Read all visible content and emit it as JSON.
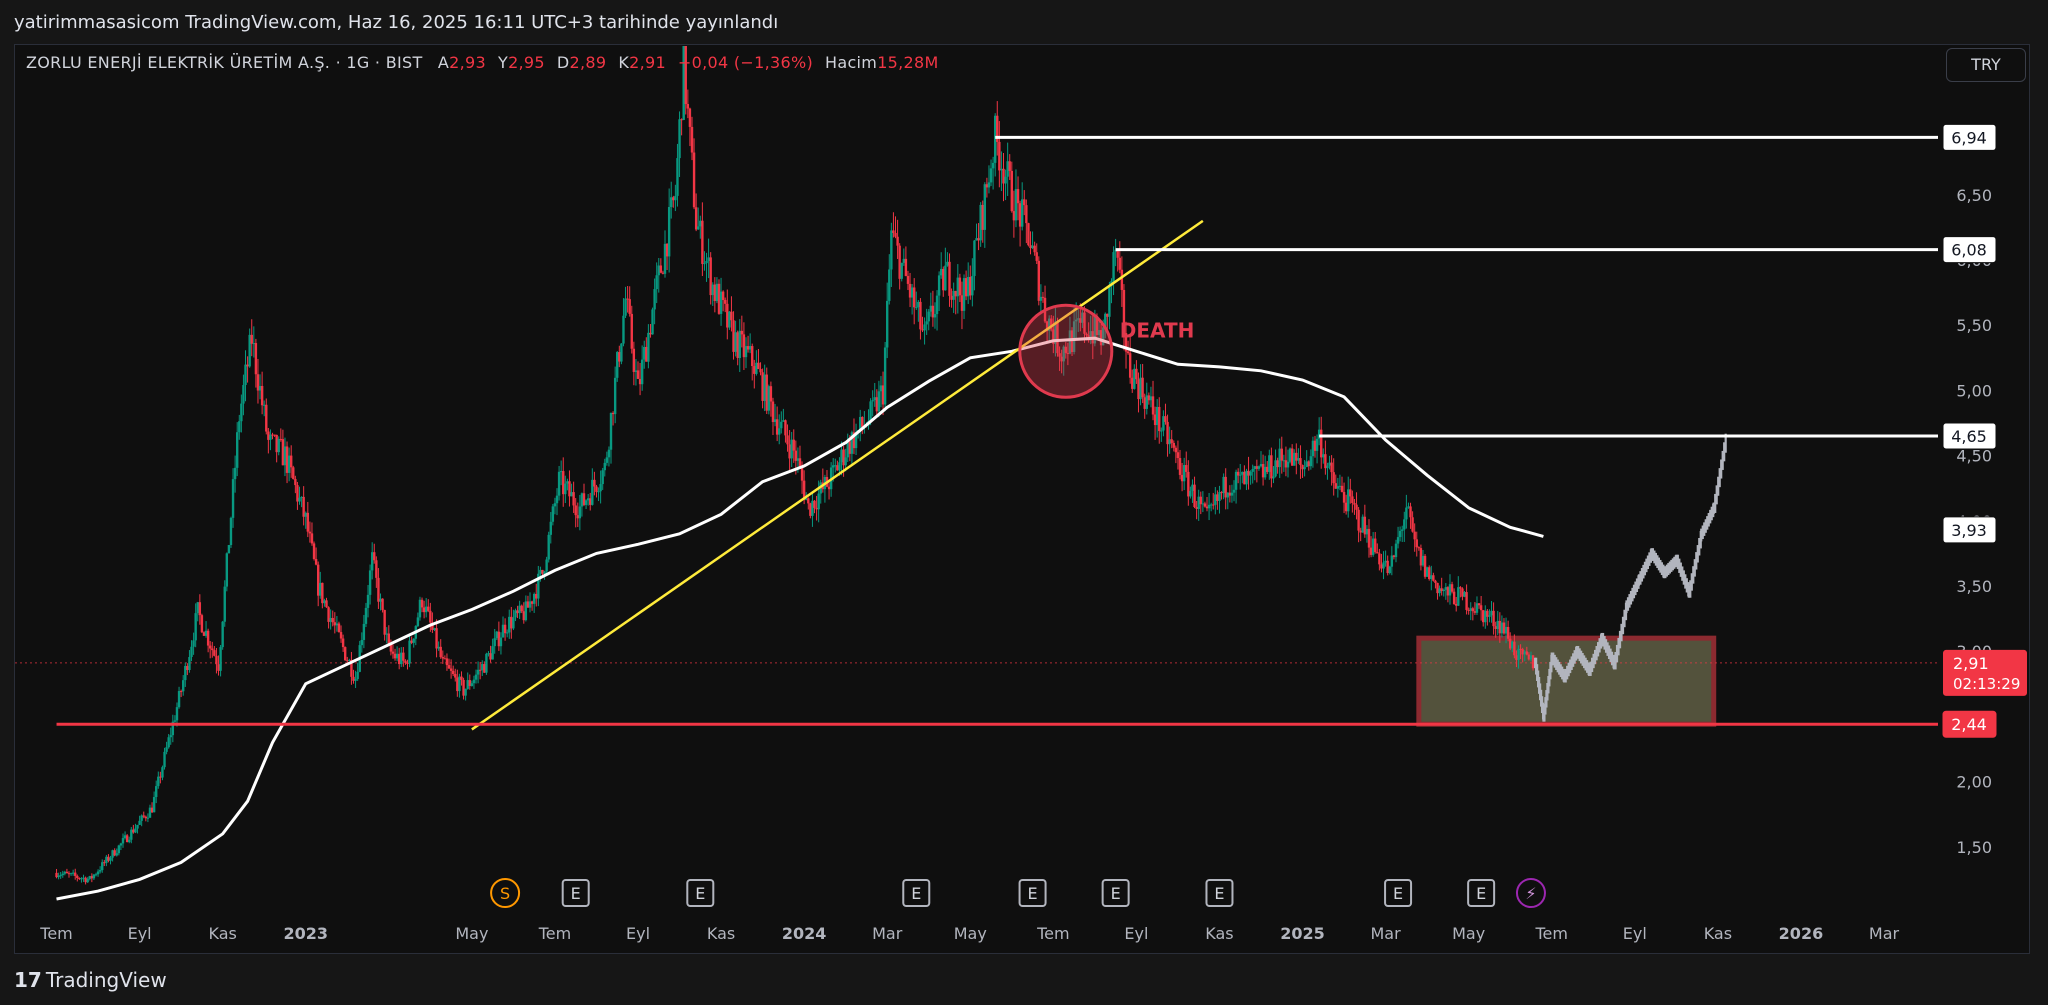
{
  "header": {
    "publish_line": "yatirimmasasicom TradingView.com, Haz 16, 2025 16:11 UTC+3 tarihinde yayınlandı"
  },
  "legend": {
    "symbol_line": "ZORLU ENERJİ ELEKTRİK ÜRETİM A.Ş. · 1G · BIST",
    "open_label": "A",
    "open": "2,93",
    "high_label": "Y",
    "high": "2,95",
    "low_label": "D",
    "low": "2,89",
    "close_label": "K",
    "close": "2,91",
    "change": "−0,04 (−1,36%)",
    "volume_label": "Hacim",
    "volume": "15,28M"
  },
  "currency_button": "TRY",
  "footer": {
    "brand": "TradingView",
    "logo_glyph": "17"
  },
  "colors": {
    "background": "#0f0f0f",
    "up": "#089981",
    "down": "#f23645",
    "moving_average": "#ffffff",
    "trendline": "#ffeb3b",
    "support_line": "#f23645",
    "projection": "#b2b5be",
    "zone_fill": "#6b6a4c",
    "zone_border": "#8c2a30",
    "death_circle": "#e03a4e"
  },
  "chart_data": {
    "type": "candlestick",
    "y_axis": {
      "scale": "linear",
      "range": [
        1.2,
        7.7
      ],
      "ticks": [
        "1,50",
        "2,00",
        "2,50",
        "3,00",
        "3,50",
        "4,00",
        "4,50",
        "5,00",
        "5,50",
        "6,00",
        "6,50",
        "7,00",
        "7,50"
      ],
      "tick_values": [
        1.5,
        2.0,
        2.5,
        3.0,
        3.5,
        4.0,
        4.5,
        5.0,
        5.5,
        6.0,
        6.5,
        7.0,
        7.5
      ]
    },
    "x_axis": {
      "labels": [
        "Tem",
        "Eyl",
        "Kas",
        "2023",
        "May",
        "Tem",
        "Eyl",
        "Kas",
        "2024",
        "Mar",
        "May",
        "Tem",
        "Eyl",
        "Kas",
        "2025",
        "Mar",
        "May",
        "Tem",
        "Eyl",
        "Kas",
        "2026",
        "Mar"
      ],
      "label_months": [
        0,
        2,
        4,
        6,
        10,
        12,
        14,
        16,
        18,
        20,
        22,
        24,
        26,
        28,
        30,
        32,
        34,
        36,
        38,
        40,
        42,
        44
      ],
      "month_zero": "2022-07"
    },
    "price_path": [
      [
        0.0,
        1.3
      ],
      [
        0.8,
        1.25
      ],
      [
        1.5,
        1.5
      ],
      [
        2.3,
        1.8
      ],
      [
        3.0,
        2.7
      ],
      [
        3.4,
        3.3
      ],
      [
        3.9,
        2.9
      ],
      [
        4.4,
        4.8
      ],
      [
        4.7,
        5.4
      ],
      [
        5.1,
        4.6
      ],
      [
        5.5,
        4.5
      ],
      [
        6.0,
        4.0
      ],
      [
        6.3,
        3.5
      ],
      [
        6.8,
        3.1
      ],
      [
        7.2,
        2.8
      ],
      [
        7.6,
        3.7
      ],
      [
        8.0,
        3.0
      ],
      [
        8.4,
        2.9
      ],
      [
        8.8,
        3.4
      ],
      [
        9.3,
        2.9
      ],
      [
        9.8,
        2.7
      ],
      [
        10.3,
        2.9
      ],
      [
        10.8,
        3.2
      ],
      [
        11.3,
        3.3
      ],
      [
        11.7,
        3.6
      ],
      [
        12.1,
        4.3
      ],
      [
        12.6,
        4.1
      ],
      [
        13.2,
        4.4
      ],
      [
        13.7,
        5.7
      ],
      [
        14.0,
        5.0
      ],
      [
        14.4,
        5.7
      ],
      [
        14.9,
        6.5
      ],
      [
        15.1,
        7.5
      ],
      [
        15.4,
        6.3
      ],
      [
        15.8,
        5.8
      ],
      [
        16.3,
        5.4
      ],
      [
        16.8,
        5.2
      ],
      [
        17.3,
        4.8
      ],
      [
        17.8,
        4.5
      ],
      [
        18.1,
        4.1
      ],
      [
        18.6,
        4.3
      ],
      [
        19.1,
        4.6
      ],
      [
        19.6,
        4.8
      ],
      [
        19.9,
        5.0
      ],
      [
        20.1,
        6.2
      ],
      [
        20.5,
        5.8
      ],
      [
        20.9,
        5.4
      ],
      [
        21.4,
        5.9
      ],
      [
        21.9,
        5.7
      ],
      [
        22.2,
        6.2
      ],
      [
        22.6,
        6.94
      ],
      [
        23.0,
        6.5
      ],
      [
        23.4,
        6.2
      ],
      [
        23.8,
        5.6
      ],
      [
        24.2,
        5.3
      ],
      [
        24.7,
        5.5
      ],
      [
        25.2,
        5.4
      ],
      [
        25.5,
        6.08
      ],
      [
        25.8,
        5.2
      ],
      [
        26.3,
        4.9
      ],
      [
        26.8,
        4.6
      ],
      [
        27.2,
        4.3
      ],
      [
        27.7,
        4.0
      ],
      [
        28.2,
        4.3
      ],
      [
        28.7,
        4.3
      ],
      [
        29.2,
        4.4
      ],
      [
        29.6,
        4.5
      ],
      [
        30.0,
        4.4
      ],
      [
        30.4,
        4.65
      ],
      [
        30.7,
        4.3
      ],
      [
        31.2,
        4.1
      ],
      [
        31.7,
        3.8
      ],
      [
        32.1,
        3.6
      ],
      [
        32.5,
        4.1
      ],
      [
        32.7,
        3.8
      ],
      [
        33.0,
        3.6
      ],
      [
        33.4,
        3.45
      ],
      [
        33.9,
        3.4
      ],
      [
        34.3,
        3.3
      ],
      [
        34.8,
        3.2
      ],
      [
        35.2,
        2.95
      ],
      [
        35.6,
        2.91
      ]
    ],
    "moving_average_path": [
      [
        0.0,
        1.1
      ],
      [
        1.0,
        1.16
      ],
      [
        2.0,
        1.25
      ],
      [
        3.0,
        1.38
      ],
      [
        4.0,
        1.6
      ],
      [
        4.6,
        1.85
      ],
      [
        5.2,
        2.3
      ],
      [
        6.0,
        2.75
      ],
      [
        7.0,
        2.9
      ],
      [
        8.0,
        3.05
      ],
      [
        9.0,
        3.2
      ],
      [
        10.0,
        3.32
      ],
      [
        11.0,
        3.46
      ],
      [
        12.0,
        3.62
      ],
      [
        13.0,
        3.75
      ],
      [
        14.0,
        3.82
      ],
      [
        15.0,
        3.9
      ],
      [
        16.0,
        4.05
      ],
      [
        17.0,
        4.3
      ],
      [
        18.0,
        4.42
      ],
      [
        19.0,
        4.6
      ],
      [
        20.0,
        4.87
      ],
      [
        21.0,
        5.07
      ],
      [
        22.0,
        5.25
      ],
      [
        23.0,
        5.3
      ],
      [
        24.0,
        5.38
      ],
      [
        25.0,
        5.4
      ],
      [
        26.0,
        5.3
      ],
      [
        27.0,
        5.2
      ],
      [
        28.0,
        5.18
      ],
      [
        29.0,
        5.15
      ],
      [
        30.0,
        5.08
      ],
      [
        31.0,
        4.95
      ],
      [
        32.0,
        4.62
      ],
      [
        33.0,
        4.35
      ],
      [
        34.0,
        4.1
      ],
      [
        35.0,
        3.95
      ],
      [
        35.8,
        3.88
      ]
    ],
    "projection_path": [
      [
        35.6,
        2.91
      ],
      [
        35.8,
        2.5
      ],
      [
        36.0,
        2.95
      ],
      [
        36.3,
        2.8
      ],
      [
        36.6,
        3.0
      ],
      [
        36.9,
        2.85
      ],
      [
        37.2,
        3.1
      ],
      [
        37.5,
        2.9
      ],
      [
        37.8,
        3.35
      ],
      [
        38.1,
        3.55
      ],
      [
        38.4,
        3.75
      ],
      [
        38.7,
        3.6
      ],
      [
        39.0,
        3.7
      ],
      [
        39.3,
        3.45
      ],
      [
        39.6,
        3.9
      ],
      [
        39.9,
        4.1
      ],
      [
        40.2,
        4.65
      ]
    ],
    "trendline": {
      "from": [
        10.0,
        2.4
      ],
      "to": [
        27.6,
        6.3
      ]
    },
    "horizontal_levels": [
      {
        "value": 6.94,
        "label": "6,94",
        "from_month": 22.6,
        "color": "#ffffff"
      },
      {
        "value": 6.08,
        "label": "6,08",
        "from_month": 25.5,
        "color": "#ffffff"
      },
      {
        "value": 4.65,
        "label": "4,65",
        "from_month": 30.4,
        "color": "#ffffff"
      },
      {
        "value": 2.44,
        "label": "2,44",
        "from_month": 0,
        "color": "#f23645"
      }
    ],
    "extra_price_labels": [
      {
        "value": 3.93,
        "label": "3,93"
      }
    ],
    "current_price": {
      "value": 2.91,
      "label": "2,91",
      "countdown": "02:13:29"
    },
    "zone": {
      "x1": 32.8,
      "x2": 39.9,
      "y1": 2.44,
      "y2": 3.1
    },
    "death_cross": {
      "month": 24.3,
      "value": 5.3,
      "label": "DEATH"
    },
    "events": [
      {
        "month": 10.8,
        "glyph": "S",
        "kind": "split"
      },
      {
        "month": 12.5,
        "glyph": "E",
        "kind": "earnings"
      },
      {
        "month": 15.5,
        "glyph": "E",
        "kind": "earnings"
      },
      {
        "month": 20.7,
        "glyph": "E",
        "kind": "earnings"
      },
      {
        "month": 23.5,
        "glyph": "E",
        "kind": "earnings"
      },
      {
        "month": 25.5,
        "glyph": "E",
        "kind": "earnings"
      },
      {
        "month": 28.0,
        "glyph": "E",
        "kind": "earnings"
      },
      {
        "month": 32.3,
        "glyph": "E",
        "kind": "earnings"
      },
      {
        "month": 34.3,
        "glyph": "E",
        "kind": "earnings"
      },
      {
        "month": 35.5,
        "glyph": "⚡",
        "kind": "dividend"
      }
    ]
  }
}
